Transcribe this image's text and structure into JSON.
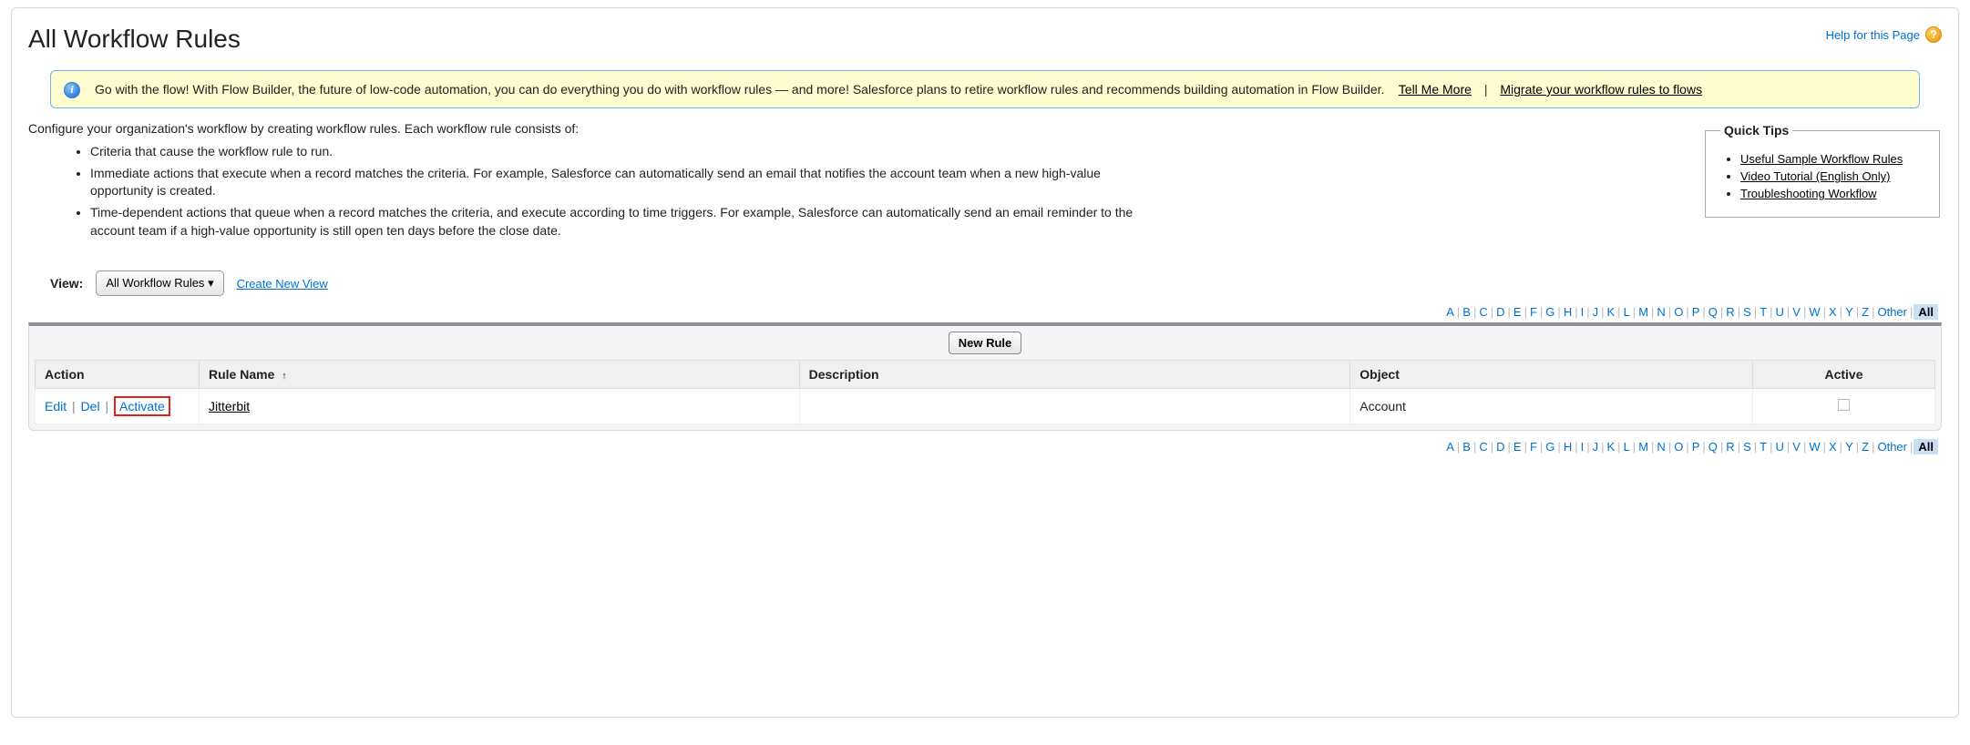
{
  "header": {
    "title": "All Workflow Rules",
    "help_label": "Help for this Page"
  },
  "banner": {
    "text_prefix": "Go with the flow! With Flow Builder, the future of low-code automation, you can do everything you do with workflow rules — and more! Salesforce plans to retire workflow rules and recommends building automation in Flow Builder.",
    "link_tell_more": "Tell Me More",
    "link_migrate": "Migrate your workflow rules to flows"
  },
  "intro": {
    "lead": "Configure your organization's workflow by creating workflow rules. Each workflow rule consists of:",
    "bullets": [
      "Criteria that cause the workflow rule to run.",
      "Immediate actions that execute when a record matches the criteria. For example, Salesforce can automatically send an email that notifies the account team when a new high-value opportunity is created.",
      "Time-dependent actions that queue when a record matches the criteria, and execute according to time triggers. For example, Salesforce can automatically send an email reminder to the account team if a high-value opportunity is still open ten days before the close date."
    ]
  },
  "quick_tips": {
    "legend": "Quick Tips",
    "links": [
      "Useful Sample Workflow Rules",
      "Video Tutorial (English Only)",
      "Troubleshooting Workflow"
    ]
  },
  "view": {
    "label": "View:",
    "selected": "All Workflow Rules",
    "create_label": "Create New View"
  },
  "rolodex": {
    "letters": [
      "A",
      "B",
      "C",
      "D",
      "E",
      "F",
      "G",
      "H",
      "I",
      "J",
      "K",
      "L",
      "M",
      "N",
      "O",
      "P",
      "Q",
      "R",
      "S",
      "T",
      "U",
      "V",
      "W",
      "X",
      "Y",
      "Z"
    ],
    "other": "Other",
    "all": "All"
  },
  "table": {
    "new_button": "New Rule",
    "columns": {
      "action": "Action",
      "rule_name": "Rule Name",
      "description": "Description",
      "object": "Object",
      "active": "Active"
    },
    "rows": [
      {
        "edit": "Edit",
        "del": "Del",
        "activate": "Activate",
        "rule_name": "Jitterbit",
        "description": "",
        "object": "Account",
        "active": false
      }
    ]
  }
}
